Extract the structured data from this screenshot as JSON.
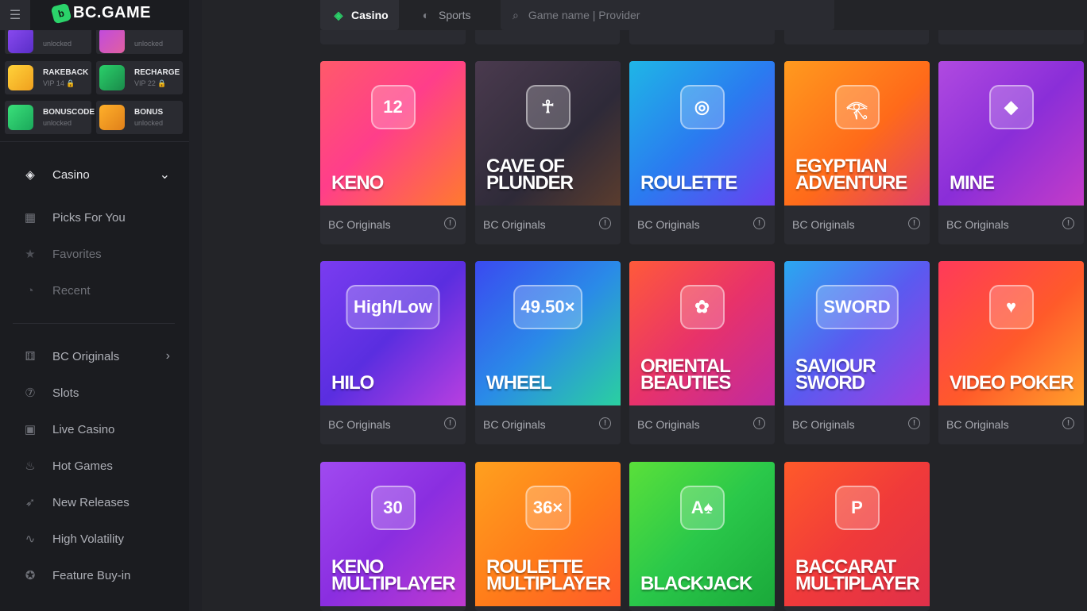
{
  "header": {
    "logo_text": "BC.GAME",
    "tabs": [
      {
        "label": "Casino",
        "icon": "casino-diamond-icon"
      },
      {
        "label": "Sports",
        "icon": "sports-ball-icon"
      }
    ],
    "search_placeholder": "Game name | Provider"
  },
  "sidebar": {
    "promos": [
      {
        "title": "",
        "subtitle": "unlocked"
      },
      {
        "title": "",
        "subtitle": "unlocked"
      },
      {
        "title": "RAKEBACK",
        "subtitle": "VIP 14 🔒"
      },
      {
        "title": "RECHARGE",
        "subtitle": "VIP 22 🔒"
      },
      {
        "title": "BONUSCODE",
        "subtitle": "unlocked"
      },
      {
        "title": "BONUS",
        "subtitle": "unlocked"
      }
    ],
    "casino_label": "Casino",
    "sub_items": [
      {
        "label": "Picks For You",
        "icon": "grid-icon"
      },
      {
        "label": "Favorites",
        "icon": "star-icon"
      },
      {
        "label": "Recent",
        "icon": "clock-icon"
      }
    ],
    "categories": [
      {
        "label": "BC Originals",
        "icon": "dice-icon"
      },
      {
        "label": "Slots",
        "icon": "slot-icon"
      },
      {
        "label": "Live Casino",
        "icon": "cards-icon"
      },
      {
        "label": "Hot Games",
        "icon": "flame-icon"
      },
      {
        "label": "New Releases",
        "icon": "rocket-icon"
      },
      {
        "label": "High Volatility",
        "icon": "pulse-icon"
      },
      {
        "label": "Feature Buy-in",
        "icon": "star-badge-icon"
      }
    ]
  },
  "games": [
    {
      "name": "KENO",
      "provider": "BC Originals",
      "bg": "linear-gradient(135deg,#ff5a6a 0%,#ff3e8a 45%,#ff7a2e 100%)",
      "deco": "12"
    },
    {
      "name": "CAVE OF\nPLUNDER",
      "provider": "BC Originals",
      "bg": "linear-gradient(135deg,#4a3a4e 0%,#2e2a38 60%,#5a3c2e 100%)",
      "deco": "☥"
    },
    {
      "name": "ROULETTE",
      "provider": "BC Originals",
      "bg": "linear-gradient(135deg,#1fb6e6 0%,#2a7bf0 50%,#6a3ff0 100%)",
      "deco": "◎"
    },
    {
      "name": "EGYPTIAN\nADVENTURE",
      "provider": "BC Originals",
      "bg": "linear-gradient(135deg,#ff9a1e 0%,#ff6a1a 55%,#e0406a 100%)",
      "deco": "𓂀"
    },
    {
      "name": "MINE",
      "provider": "BC Originals",
      "bg": "linear-gradient(135deg,#b04ae0 0%,#8a2ed8 50%,#c43cc8 100%)",
      "deco": "◆"
    },
    {
      "name": "HILO",
      "provider": "BC Originals",
      "bg": "linear-gradient(135deg,#7a3cf0 0%,#5a2ee0 50%,#b83fe0 100%)",
      "deco": "High/Low"
    },
    {
      "name": "WHEEL",
      "provider": "BC Originals",
      "bg": "linear-gradient(135deg,#3a4af0 0%,#2a8ae8 50%,#2ad0a0 100%)",
      "deco": "49.50×"
    },
    {
      "name": "ORIENTAL\nBEAUTIES",
      "provider": "BC Originals",
      "bg": "linear-gradient(135deg,#ff5a3a 0%,#e8326a 50%,#c02aa0 100%)",
      "deco": "✿"
    },
    {
      "name": "SAVIOUR\nSWORD",
      "provider": "BC Originals",
      "bg": "linear-gradient(135deg,#2aa8f0 0%,#5a5af0 50%,#a03ee0 100%)",
      "deco": "SWORD"
    },
    {
      "name": "VIDEO POKER",
      "provider": "BC Originals",
      "bg": "linear-gradient(135deg,#ff3a5a 0%,#ff5a2a 55%,#ffa02a 100%)",
      "deco": "♥"
    },
    {
      "name": "KENO\nMULTIPLAYER",
      "provider": "",
      "bg": "linear-gradient(135deg,#a04af0 0%,#8a2ee0 50%,#c03ad0 100%)",
      "deco": "30"
    },
    {
      "name": "ROULETTE\nMULTIPLAYER",
      "provider": "",
      "bg": "linear-gradient(135deg,#ffa01e 0%,#ff7a1a 55%,#ff5a2a 100%)",
      "deco": "36×"
    },
    {
      "name": "BLACKJACK",
      "provider": "",
      "bg": "linear-gradient(135deg,#5ae03a 0%,#2ac84a 50%,#1aa83a 100%)",
      "deco": "A♠"
    },
    {
      "name": "BACCARAT\nMULTIPLAYER",
      "provider": "",
      "bg": "linear-gradient(135deg,#ff5a2a 0%,#f03a3a 50%,#e0304a 100%)",
      "deco": "P"
    }
  ]
}
